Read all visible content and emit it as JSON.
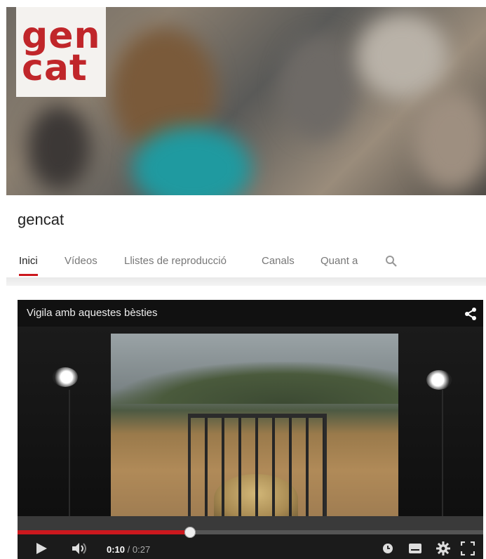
{
  "logo": {
    "line1": "gen",
    "line2": "cat"
  },
  "channel": {
    "title": "gencat"
  },
  "tabs": [
    {
      "label": "Inici",
      "active": true
    },
    {
      "label": "Vídeos",
      "active": false
    },
    {
      "label": "Llistes de reproducció",
      "active": false
    },
    {
      "label": "Canals",
      "active": false
    },
    {
      "label": "Quant a",
      "active": false
    }
  ],
  "video": {
    "title": "Vigila amb aquestes bèsties",
    "current_time": "0:10",
    "duration": " / 0:27",
    "progress_fraction": 0.37
  },
  "icons": {
    "search": "search-icon",
    "share": "share-icon",
    "play": "play-icon",
    "volume": "volume-icon",
    "watch_later": "clock-icon",
    "captions": "captions-icon",
    "settings": "gear-icon",
    "fullscreen": "fullscreen-icon"
  },
  "colors": {
    "brand_red": "#c0262a",
    "tab_active": "#cc181e"
  }
}
